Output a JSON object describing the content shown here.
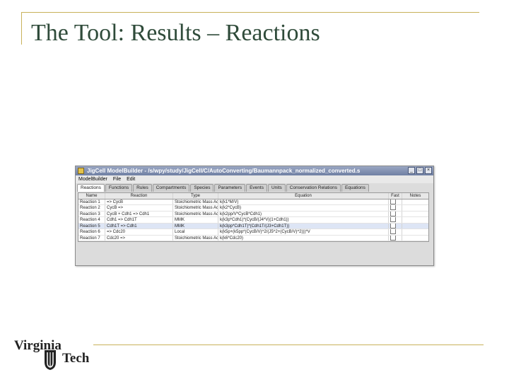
{
  "slide": {
    "title": "The Tool: Results – Reactions"
  },
  "window": {
    "title": "JigCell ModelBuilder - /s/wpy/study/JigCell/C/AutoConverting/Baumannpack_normalized_converted.s",
    "menu": [
      "ModelBuilder",
      "File",
      "Edit"
    ],
    "controls": [
      "_",
      "□",
      "×"
    ]
  },
  "tabs": [
    {
      "label": "Reactions",
      "active": true
    },
    {
      "label": "Functions"
    },
    {
      "label": "Rules"
    },
    {
      "label": "Compartments"
    },
    {
      "label": "Species"
    },
    {
      "label": "Parameters"
    },
    {
      "label": "Events"
    },
    {
      "label": "Units"
    },
    {
      "label": "Conservation Relations"
    },
    {
      "label": "Equations"
    }
  ],
  "table": {
    "headers": [
      "Name",
      "Reaction",
      "Type",
      "Equation",
      "Fast",
      "Notes"
    ],
    "rows": [
      {
        "name": "Reaction 1",
        "reaction": "=> CycB",
        "type": "Stoichiometric Mass Action",
        "equation": "k(k1*M/V)"
      },
      {
        "name": "Reaction 2",
        "reaction": "CycB =>",
        "type": "Stoichiometric Mass Action",
        "equation": "k(k2*CycB)"
      },
      {
        "name": "Reaction 3",
        "reaction": "CycB + Cdh1 => Cdh1",
        "type": "Stoichiometric Mass Action",
        "equation": "k(k2pp/V*CycB*Cdh1)"
      },
      {
        "name": "Reaction 4",
        "reaction": "Cdh1 => Cdh1T",
        "type": "MMK",
        "equation": "k(k3p*Cdh1)*(CycB/(J4*V)(1+Cdh1))"
      },
      {
        "name": "Reaction 5",
        "reaction": "Cdh1T => Cdh1",
        "type": "MMK",
        "equation": "k(k3pp*Cdh1T)*(Cdh1T/(J3+Cdh1T))"
      },
      {
        "name": "Reaction 6",
        "reaction": "=> Cdc20",
        "type": "Local",
        "equation": "k(k5p+(k5pp*(CycB/V)^2/(J5^2+(CycB/V)^2)))*V"
      },
      {
        "name": "Reaction 7",
        "reaction": "Cdc20 =>",
        "type": "Stoichiometric Mass Action",
        "equation": "k(k6*Cdc20)"
      }
    ]
  },
  "logo": {
    "top_text": "Virginia",
    "bottom_text": "Tech",
    "icon": "shield-icon"
  },
  "colors": {
    "rule": "#c8b25a",
    "title": "#2f4b3a"
  }
}
